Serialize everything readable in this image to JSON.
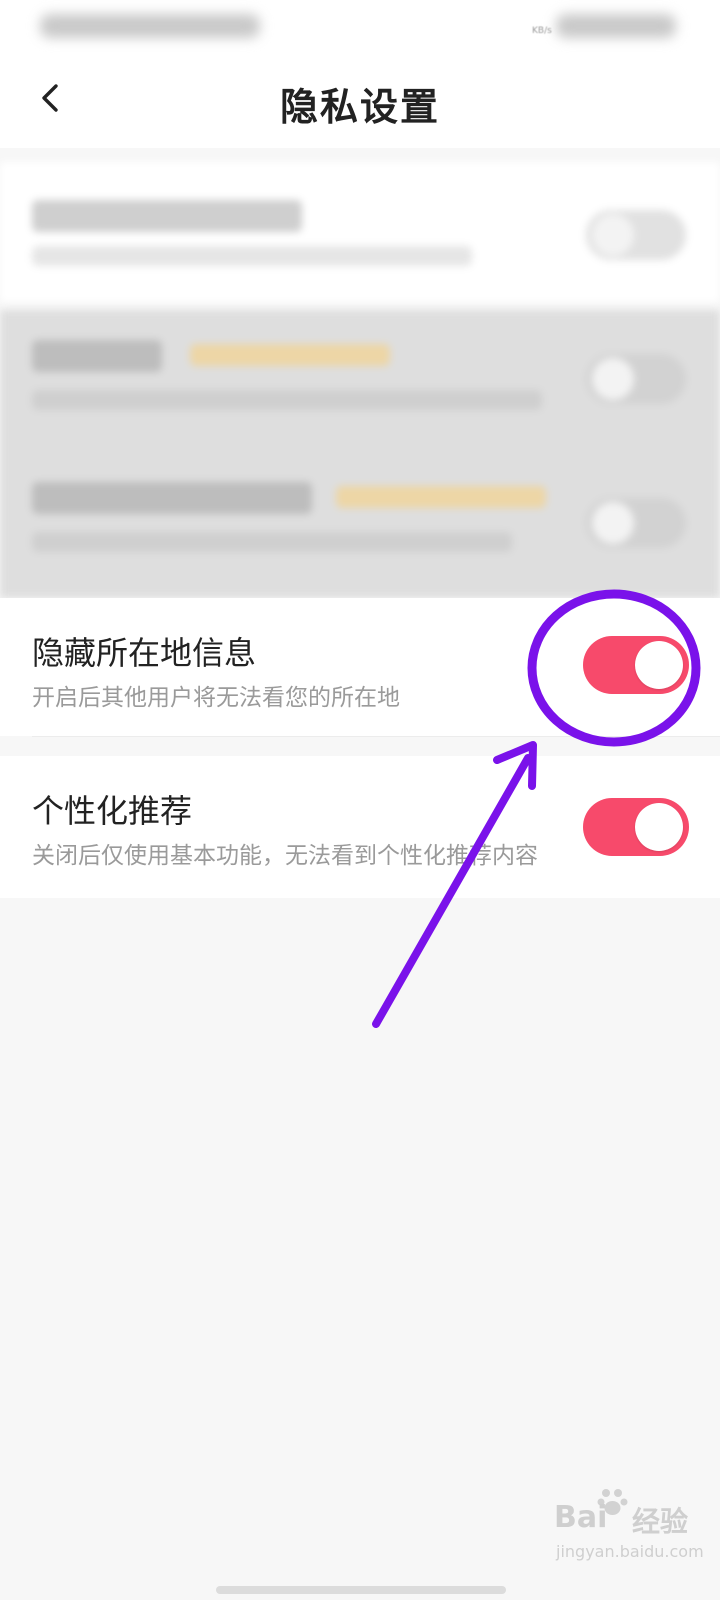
{
  "status_bar": {
    "speed_unit": "KB/s"
  },
  "header": {
    "title": "隐私设置"
  },
  "settings": [
    {
      "title": "隐藏所在地信息",
      "description": "开启后其他用户将无法看您的所在地",
      "enabled": true
    },
    {
      "title": "个性化推荐",
      "description": "关闭后仅使用基本功能，无法看到个性化推荐内容",
      "enabled": true
    }
  ],
  "colors": {
    "switch_on": "#f74a6b",
    "annotation": "#7a12ea"
  },
  "watermark": {
    "brand": "Bai",
    "brand_cn": "经验",
    "url": "jingyan.baidu.com"
  },
  "icons": {
    "back": "chevron-left-icon",
    "watermark": "paw-icon"
  }
}
